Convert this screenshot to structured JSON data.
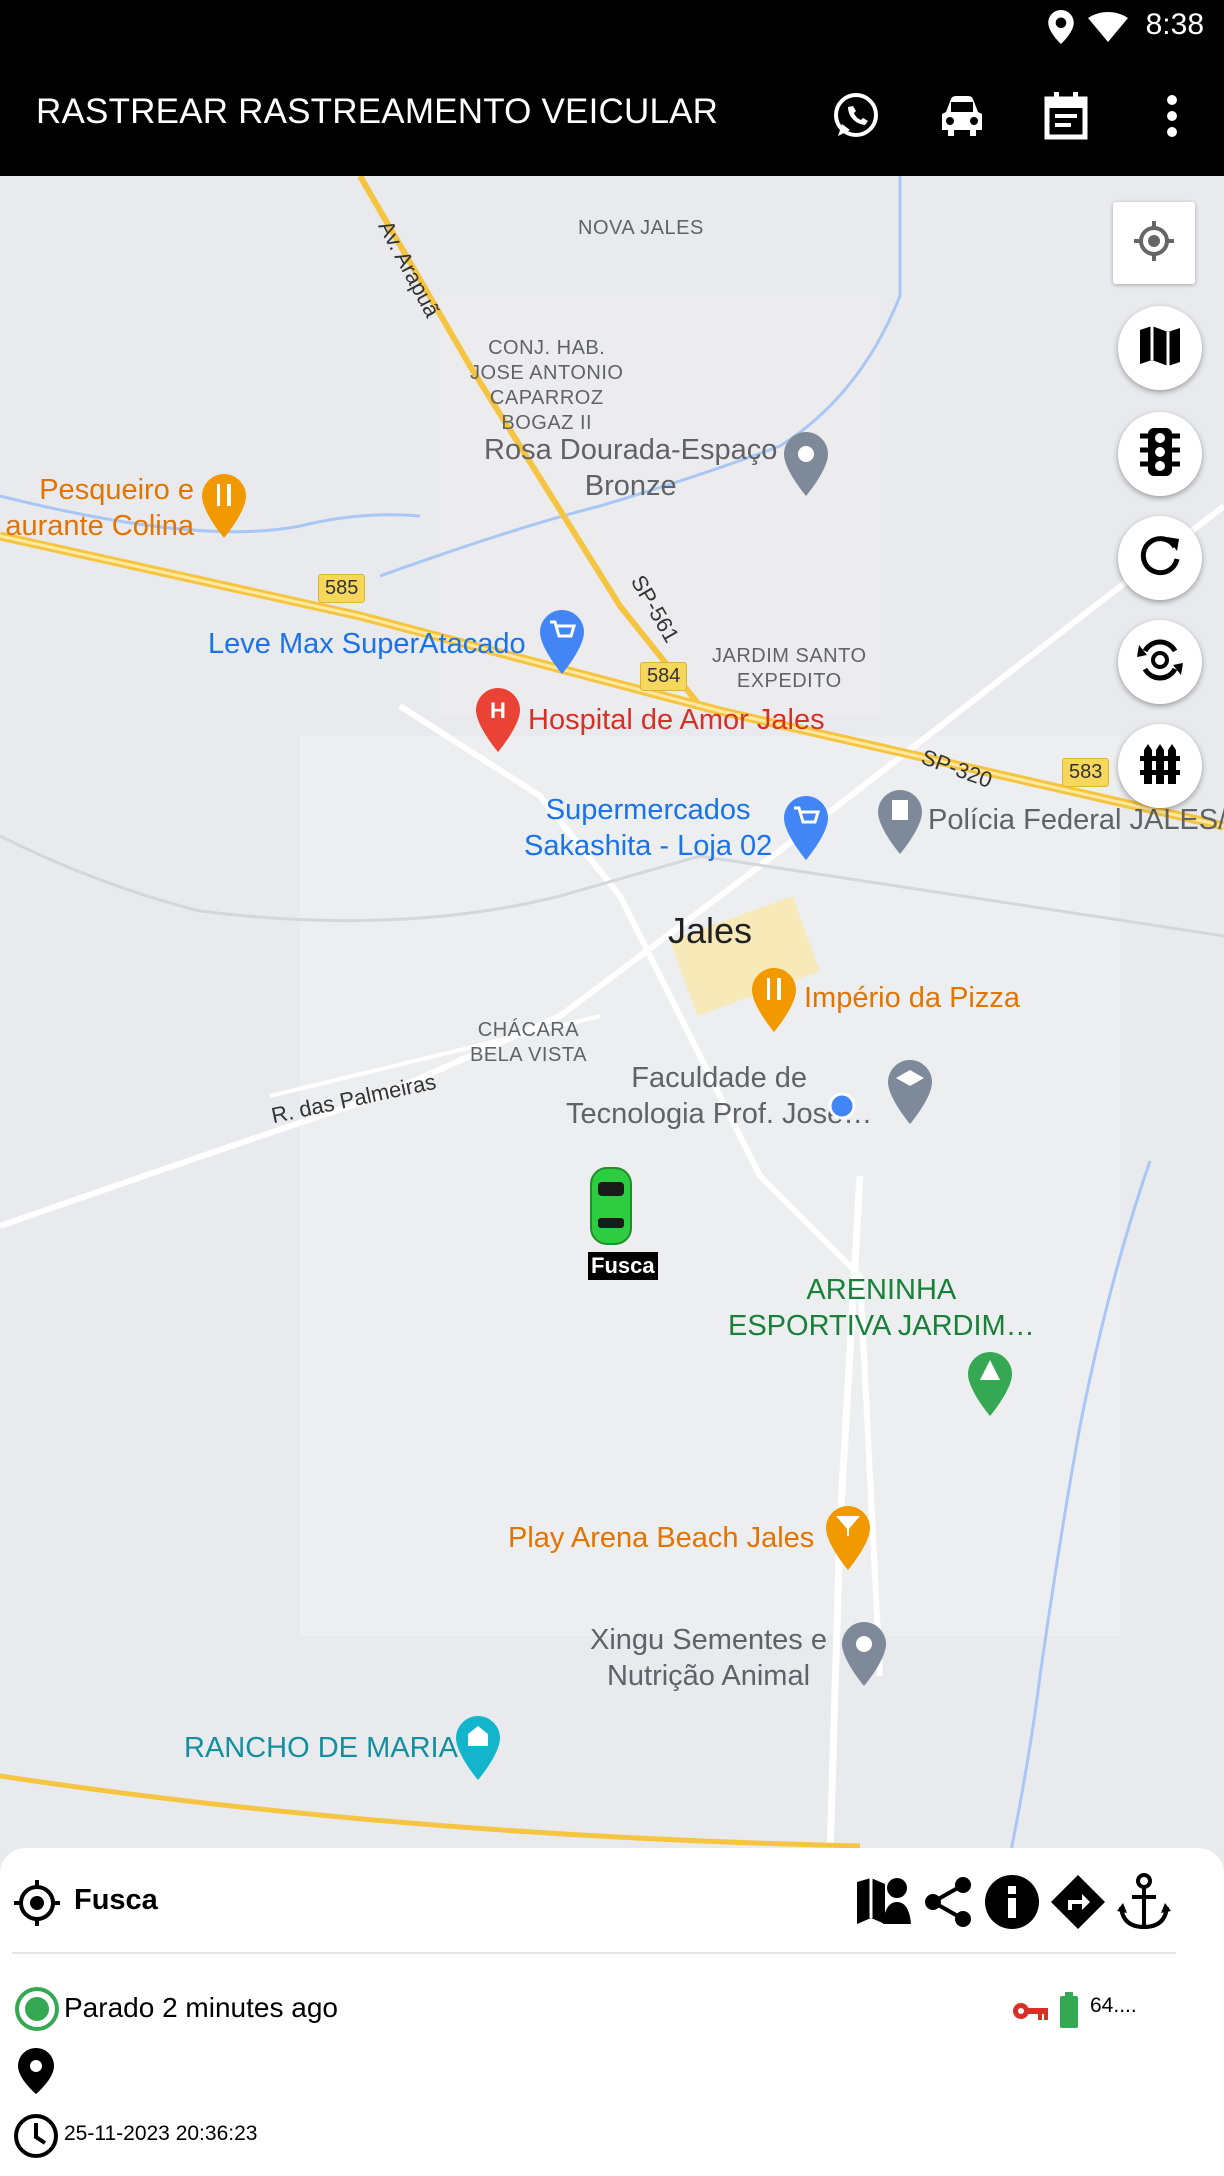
{
  "status_bar": {
    "time": "8:38"
  },
  "app_bar": {
    "title": "RASTREAR RASTREAMENTO VEICULAR",
    "actions": [
      "whatsapp-icon",
      "car-icon",
      "calendar-icon",
      "more-vert-icon"
    ]
  },
  "map": {
    "areas": {
      "nova_jales": "NOVA JALES",
      "conj_hab": "CONJ. HAB.\nJOSE ANTONIO\nCAPARROZ\nBOGAZ II",
      "jardim_santo": "JARDIM SANTO\nEXPEDITO",
      "chacara": "CHÁCARA\nBELA VISTA"
    },
    "city": "Jales",
    "roads": {
      "arapua": "Av. Arapuã",
      "sp561": "SP-561",
      "sp320": "SP-320",
      "palmeiras": "R. das Palmeiras",
      "shield_585": "585",
      "shield_584": "584",
      "shield_583": "583"
    },
    "pois": {
      "rosa": "Rosa Dourada-Espaço\nBronze",
      "pesqueiro": "Pesqueiro e\naurante Colina",
      "levemax": "Leve Max SuperAtacado",
      "hospital": "Hospital de Amor Jales",
      "super": "Supermercados\nSakashita - Loja 02",
      "policia": "Polícia Federal JALES/",
      "imperio": "Império da Pizza",
      "faculdade": "Faculdade de\nTecnologia Prof. José…",
      "areninha": "ARENINHA\nESPORTIVA JARDIM…",
      "play": "Play Arena Beach Jales",
      "xingu": "Xingu Sementes e\nNutrição Animal",
      "rancho": "RANCHO DE MARIA"
    },
    "vehicle_label": "Fusca",
    "controls": [
      "my-location-icon",
      "map-type-icon",
      "traffic-icon",
      "refresh-icon",
      "auto-refresh-icon",
      "geofence-icon"
    ]
  },
  "panel": {
    "vehicle_name": "Fusca",
    "status": "Parado 2 minutes ago",
    "battery": "64....",
    "datetime": "25-11-2023 20:36:23",
    "actions": [
      "map-user-icon",
      "share-icon",
      "info-icon",
      "directions-icon",
      "anchor-icon"
    ]
  },
  "colors": {
    "highway": "#f5c542",
    "status_green": "#34a853",
    "key_red": "#d93025",
    "battery_green": "#34a853",
    "water": "#9ec0f5"
  }
}
